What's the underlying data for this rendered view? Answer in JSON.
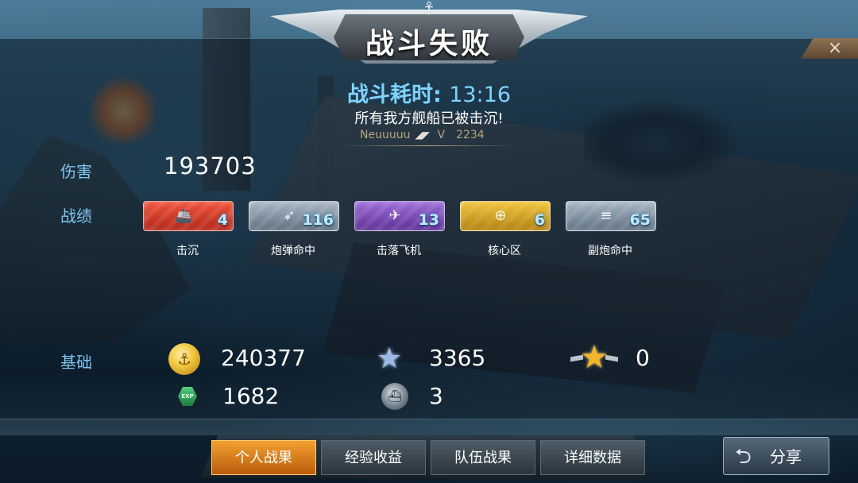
{
  "header": {
    "title": "战斗失败",
    "close_label": "×"
  },
  "summary": {
    "time_label": "战斗耗时:",
    "time_value": "13:16",
    "message": "所有我方舰船已被击沉!",
    "player_name": "Neuuuuu",
    "player_level_prefix": "V",
    "player_level": "2234"
  },
  "damage": {
    "label": "伤害",
    "value": "193703"
  },
  "record": {
    "label": "战绩",
    "items": [
      {
        "name": "击沉",
        "count": "4",
        "color": "#d83a26",
        "icon": "ship-sunk-icon"
      },
      {
        "name": "炮弹命中",
        "count": "116",
        "color": "#7f91a3",
        "icon": "shell-hit-icon"
      },
      {
        "name": "击落飞机",
        "count": "13",
        "color": "#7a4cbc",
        "icon": "plane-shot-icon"
      },
      {
        "name": "核心区",
        "count": "6",
        "color": "#d9a01f",
        "icon": "core-hit-icon"
      },
      {
        "name": "副炮命中",
        "count": "65",
        "color": "#7f91a3",
        "icon": "secondary-gun-icon"
      }
    ]
  },
  "base": {
    "label": "基础",
    "silver": "240377",
    "exp": "1682",
    "star": "3365",
    "medal": "0",
    "ship_count": "3"
  },
  "tabs": [
    {
      "label": "个人战果",
      "active": true
    },
    {
      "label": "经验收益",
      "active": false
    },
    {
      "label": "队伍战果",
      "active": false
    },
    {
      "label": "详细数据",
      "active": false
    }
  ],
  "share": {
    "label": "分享"
  },
  "colors": {
    "accent": "#7fd2ff",
    "label": "#7fc6f2",
    "active_tab": "#f3a030"
  }
}
